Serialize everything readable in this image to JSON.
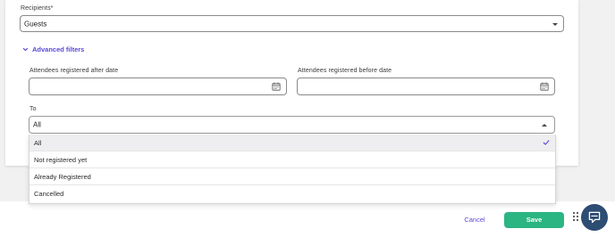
{
  "form": {
    "recipients_label": "Recipients*",
    "recipients_value": "Guests",
    "advanced_filters_label": "Advanced filters",
    "after_date_label": "Attendees registered after date",
    "after_date_value": "",
    "before_date_label": "Attendees registered before date",
    "before_date_value": "",
    "to_label": "To",
    "to_value": "All"
  },
  "to_dropdown": {
    "expanded": true,
    "options": [
      {
        "label": "All",
        "selected": true
      },
      {
        "label": "Not registered yet",
        "selected": false
      },
      {
        "label": "Already Registered",
        "selected": false
      },
      {
        "label": "Cancelled",
        "selected": false
      }
    ]
  },
  "footer": {
    "cancel_label": "Cancel",
    "save_label": "Save"
  },
  "colors": {
    "accent": "#5b49d6",
    "save_button": "#2bb583",
    "chat_button": "#2e4d73"
  },
  "icons": {
    "advanced_toggle": "chevron-down-icon",
    "date_picker": "calendar-icon",
    "select_collapsed": "caret-down-icon",
    "select_expanded": "caret-up-icon",
    "selected_option": "check-icon",
    "drag_handle": "grip-icon",
    "chat": "chat-icon"
  }
}
